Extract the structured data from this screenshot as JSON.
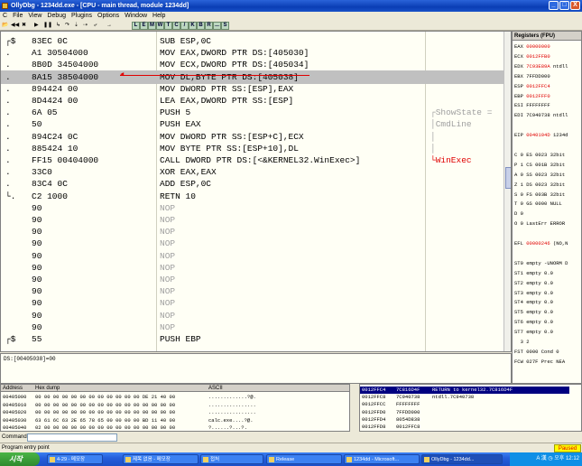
{
  "window": {
    "title": "OllyDbg - 1234dd.exe - [CPU - main thread, module 1234dd]",
    "minimize": "_",
    "maximize": "□",
    "close": "X"
  },
  "menu": [
    "C",
    "File",
    "View",
    "Debug",
    "Plugins",
    "Options",
    "Window",
    "Help"
  ],
  "toolbar": {
    "letters": [
      "L",
      "E",
      "M",
      "W",
      "T",
      "C",
      "/",
      "K",
      "B",
      "R",
      "...",
      "S"
    ],
    "tool_icons": [
      "open",
      "restart",
      "close",
      "run",
      "pause",
      "step-into",
      "step-over",
      "trace-into",
      "trace-over",
      "execute-till-return",
      "goto"
    ]
  },
  "disasm": {
    "rows": [
      {
        "mark": "┌$",
        "hex": "83EC 0C",
        "cmd": "SUB ESP,0C",
        "comment": ""
      },
      {
        "mark": ".",
        "hex": "A1 30504000",
        "cmd": "MOV EAX,DWORD PTR DS:[405030]",
        "comment": ""
      },
      {
        "mark": ".",
        "hex": "8B0D 34504000",
        "cmd": "MOV ECX,DWORD PTR DS:[405034]",
        "comment": ""
      },
      {
        "mark": ".",
        "hex": "8A15 38504000",
        "cmd": "MOV DL,BYTE PTR DS:[405038]",
        "comment": ""
      },
      {
        "mark": ".",
        "hex": "894424 00",
        "cmd": "MOV DWORD PTR SS:[ESP],EAX",
        "comment": ""
      },
      {
        "mark": ".",
        "hex": "8D4424 00",
        "cmd": "LEA EAX,DWORD PTR SS:[ESP]",
        "comment": ""
      },
      {
        "mark": ".",
        "hex": "6A 05",
        "cmd": "PUSH 5",
        "comment": "┌ShowState ="
      },
      {
        "mark": ".",
        "hex": "50",
        "cmd": "PUSH EAX",
        "comment": "│CmdLine"
      },
      {
        "mark": ".",
        "hex": "894C24 0C",
        "cmd": "MOV DWORD PTR SS:[ESP+C],ECX",
        "comment": "│"
      },
      {
        "mark": ".",
        "hex": "885424 10",
        "cmd": "MOV BYTE PTR SS:[ESP+10],DL",
        "comment": "│"
      },
      {
        "mark": ".",
        "hex": "FF15 00404000",
        "cmd": "CALL DWORD PTR DS:[<&KERNEL32.WinExec>]",
        "comment": "└WinExec"
      },
      {
        "mark": ".",
        "hex": "33C0",
        "cmd": "XOR EAX,EAX",
        "comment": ""
      },
      {
        "mark": ".",
        "hex": "83C4 0C",
        "cmd": "ADD ESP,0C",
        "comment": ""
      },
      {
        "mark": "└.",
        "hex": "C2 1000",
        "cmd": "RETN 10",
        "comment": ""
      },
      {
        "mark": "",
        "hex": "90",
        "cmd": "NOP",
        "comment": ""
      },
      {
        "mark": "",
        "hex": "90",
        "cmd": "NOP",
        "comment": ""
      },
      {
        "mark": "",
        "hex": "90",
        "cmd": "NOP",
        "comment": ""
      },
      {
        "mark": "",
        "hex": "90",
        "cmd": "NOP",
        "comment": ""
      },
      {
        "mark": "",
        "hex": "90",
        "cmd": "NOP",
        "comment": ""
      },
      {
        "mark": "",
        "hex": "90",
        "cmd": "NOP",
        "comment": ""
      },
      {
        "mark": "",
        "hex": "90",
        "cmd": "NOP",
        "comment": ""
      },
      {
        "mark": "",
        "hex": "90",
        "cmd": "NOP",
        "comment": ""
      },
      {
        "mark": "",
        "hex": "90",
        "cmd": "NOP",
        "comment": ""
      },
      {
        "mark": "",
        "hex": "90",
        "cmd": "NOP",
        "comment": ""
      },
      {
        "mark": "",
        "hex": "90",
        "cmd": "NOP",
        "comment": ""
      },
      {
        "mark": "┌$",
        "hex": "55",
        "cmd": "PUSH EBP",
        "comment": ""
      }
    ]
  },
  "info_line": "DS:[00405038]=00",
  "registers": {
    "header": "Registers (FPU)",
    "lines": [
      {
        "n": "EAX",
        "v": "00000000",
        "c": "",
        "red": true
      },
      {
        "n": "ECX",
        "v": "0012FFB0",
        "c": "",
        "red": true
      },
      {
        "n": "EDX",
        "v": "7C93E89A",
        "c": "ntdll",
        "red": true
      },
      {
        "n": "EBX",
        "v": "7FFDD000",
        "c": "",
        "red": false
      },
      {
        "n": "ESP",
        "v": "0012FFC4",
        "c": "",
        "red": true
      },
      {
        "n": "EBP",
        "v": "0012FFF0",
        "c": "",
        "red": true
      },
      {
        "n": "ESI",
        "v": "FFFFFFFF",
        "c": "",
        "red": false
      },
      {
        "n": "EDI",
        "v": "7C940738",
        "c": "ntdll",
        "red": false
      },
      {
        "n": "",
        "v": "",
        "c": "",
        "red": false
      },
      {
        "n": "EIP",
        "v": "0040104D",
        "c": "1234d",
        "red": true
      },
      {
        "n": "",
        "v": "",
        "c": "",
        "red": false
      },
      {
        "n": "C 0",
        "v": "ES 0023",
        "c": "32bit",
        "red": false
      },
      {
        "n": "P 1",
        "v": "CS 001B",
        "c": "32bit",
        "red": false
      },
      {
        "n": "A 0",
        "v": "SS 0023",
        "c": "32bit",
        "red": false
      },
      {
        "n": "Z 1",
        "v": "DS 0023",
        "c": "32bit",
        "red": false
      },
      {
        "n": "S 0",
        "v": "FS 003B",
        "c": "32bit",
        "red": false
      },
      {
        "n": "T 0",
        "v": "GS 0000",
        "c": "NULL",
        "red": false
      },
      {
        "n": "D 0",
        "v": "",
        "c": "",
        "red": false
      },
      {
        "n": "O 0",
        "v": "LastErr",
        "c": "ERROR",
        "red": false
      },
      {
        "n": "",
        "v": "",
        "c": "",
        "red": false
      },
      {
        "n": "EFL",
        "v": "00000246",
        "c": "(NO,N",
        "red": true
      },
      {
        "n": "",
        "v": "",
        "c": "",
        "red": false
      },
      {
        "n": "ST0",
        "v": "empty",
        "c": "-UNORM D",
        "red": false
      },
      {
        "n": "ST1",
        "v": "empty",
        "c": "0.0",
        "red": false
      },
      {
        "n": "ST2",
        "v": "empty",
        "c": "0.0",
        "red": false
      },
      {
        "n": "ST3",
        "v": "empty",
        "c": "0.0",
        "red": false
      },
      {
        "n": "ST4",
        "v": "empty",
        "c": "0.0",
        "red": false
      },
      {
        "n": "ST5",
        "v": "empty",
        "c": "0.0",
        "red": false
      },
      {
        "n": "ST6",
        "v": "empty",
        "c": "0.0",
        "red": false
      },
      {
        "n": "ST7",
        "v": "empty",
        "c": "0.0",
        "red": false
      },
      {
        "n": "",
        "v": "",
        "c": "3 2",
        "red": false
      },
      {
        "n": "FST",
        "v": "0000",
        "c": "Cond 0",
        "red": false
      },
      {
        "n": "FCW",
        "v": "027F",
        "c": "Prec NEA",
        "red": false
      }
    ]
  },
  "dump": {
    "headers": {
      "address": "Address",
      "hex": "Hex dump",
      "ascii": "ASCII"
    },
    "lines": [
      {
        "addr": "00405000",
        "hex": "00 00 00 00 00 00 00 00 00 00 00 00 DE 21 40 00",
        "ascii": ".............?@."
      },
      {
        "addr": "00405010",
        "hex": "00 00 00 00 00 00 00 00 00 00 00 00 00 00 00 00",
        "ascii": "................"
      },
      {
        "addr": "00405020",
        "hex": "00 00 00 00 00 00 00 00 00 00 00 00 00 00 00 00",
        "ascii": "................"
      },
      {
        "addr": "00405030",
        "hex": "63 61 6C 63 2E 65 78 65 00 00 00 00 BD 11 40 00",
        "ascii": "calc.exe....?@."
      },
      {
        "addr": "00405040",
        "hex": "02 00 00 00 00 00 00 00 00 00 00 00 00 00 00 00",
        "ascii": "?......?...?."
      }
    ]
  },
  "stack": {
    "lines": [
      {
        "addr": "0012FFC4",
        "val": "7C816D4F",
        "c": "RETURN to kernel32.7C816D4F",
        "sel": true
      },
      {
        "addr": "0012FFC8",
        "val": "7C940738",
        "c": "ntdll.7C940738",
        "sel": false
      },
      {
        "addr": "0012FFCC",
        "val": "FFFFFFFF",
        "c": "",
        "sel": false
      },
      {
        "addr": "0012FFD0",
        "val": "7FFDD000",
        "c": "",
        "sel": false
      },
      {
        "addr": "0012FFD4",
        "val": "8054D838",
        "c": "",
        "sel": false
      },
      {
        "addr": "0012FFD8",
        "val": "0012FFC8",
        "c": "",
        "sel": false
      }
    ]
  },
  "command": {
    "label": "Command"
  },
  "status": {
    "text": "Program entry point",
    "state": "Paused"
  },
  "taskbar": {
    "start": "시작",
    "tasks": [
      "4-29 - 메모장",
      "제목 없음 - 메모장",
      "접처",
      "Release",
      "1234dd - Microsoft...",
      "OllyDbg - 1234dd..."
    ],
    "tray": "A 漢 ◷ 오후 12:12"
  }
}
